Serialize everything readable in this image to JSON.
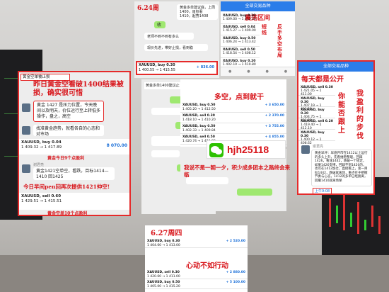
{
  "left_panel": {
    "chat_title": "黄金空单被止损",
    "headline": "昨日黄金空看破1400结果被损，确实很可惜",
    "msg1": "黄金 1427 是压力位置，今天晚间以及明天，价位运行至上转低多操作，盘之，高空",
    "msg2": "找准黄金趋势，就看各自的心态和对市场",
    "symbol": "XAUUSD, buy 0.04",
    "quote": "1 409.32 → 1 417.89",
    "profit": "8 070.00",
    "note": "黄金今日9个点盈利",
    "name": "谢君亮",
    "msg3": "黄金1421空单空，看跌，目标1414—1410 回1425",
    "red_caption": "今日早间pen回再次提供1421仲空!",
    "symbol2": "XAUUSD, sell 0.60",
    "quote2": "1 429.51 → 1 415.51",
    "note2": "黄金空单10个点盈利"
  },
  "top_mid": {
    "date_caption": "6.24周",
    "msg_top": "黄金多单建议底，上周1400，目标看1410，起势1408",
    "label": "收",
    "msg2": "老师不到不到有多么",
    "msg3": "现价先进，带好止损，看到稳",
    "symbol": "XAUUSD, buy 0.30",
    "quote": "1 400.55 → 1 415.55",
    "profit": "+ 836.00"
  },
  "top_right": {
    "app_title": "全部交易品种",
    "caption_right": "震荡区间",
    "caption_v1": "短线",
    "caption_v2": "反手多空布局",
    "rows": [
      {
        "sym": "XAUUSD, buy 0.30",
        "q": "1 409.00 → 1 412.30",
        "p": "+ 1 412.30"
      },
      {
        "sym": "XAUUSD, sell 0.04",
        "q": "1 415.27 → 1 409.00",
        "p": "+ 205.00"
      },
      {
        "sym": "XAUUSD, buy 0.50",
        "q": "1 406.24 → 1 413.42",
        "p": "+ 3 590.00"
      },
      {
        "sym": "XAUUSD, sell 0.50",
        "q": "1 418.54 → 1 408.12",
        "p": "+ 5 210.00"
      },
      {
        "sym": "XAUUSD, buy 0.20",
        "q": "1 402.10 → 1 410.80",
        "p": "+ 1 740.00"
      }
    ]
  },
  "center": {
    "chat_title": "黄金多单1400建议止",
    "caption": "多空，点到就干",
    "rows": [
      {
        "sym": "XAUUSD, buy 0.50",
        "q": "1 405.20 → 1 412.50",
        "p": "+ 3 650.00"
      },
      {
        "sym": "XAUUSD, sell 0.30",
        "q": "1 418.10 → 1 410.20",
        "p": "+ 2 370.00"
      },
      {
        "sym": "XAUUSD, buy 0.50",
        "q": "1 402.33 → 1 409.84",
        "p": "+ 3 755.00"
      },
      {
        "sym": "XAUUSD, sell 0.50",
        "q": "1 420.74 → 1 411.03",
        "p": "+ 4 855.00"
      }
    ],
    "wechat_id": "hjh25118",
    "caption2": "我说不是一朝一夕，积少成多团本之路终会来临"
  },
  "right_panel": {
    "app_title": "全部交易品种",
    "caption_top": "每天都是公开",
    "caption_v1": "你能否跟上",
    "caption_v2": "我盈利的步伐",
    "rows": [
      {
        "sym": "XAUUSD, sell 0.30",
        "q": "1 421.05 → 1 411.00",
        "p": "+ 4 000.00"
      },
      {
        "sym": "XAUUSD, buy 0.30",
        "q": "1 407.19 → 1 413.50",
        "p": "+ 1 893.00"
      },
      {
        "sym": "XAUUSD, buy 0.20",
        "q": "1 404.75 → 1 411.80",
        "p": "+ 1 410.00"
      },
      {
        "sym": "XAUUSD, sell 0.20",
        "q": "1 419.40 → 1 412.10",
        "p": "+ 1 460.00"
      },
      {
        "sym": "XAUUSD, buy 0.30",
        "q": "1 400.12 → 1 408.62",
        "p": "+ 2 550.00"
      }
    ],
    "name": "谢君亮",
    "msg": "黄金早评：早盘开市在1412以上运行的多头上升，先看维稳整理，回踩1426，看涨1442，跌破一个短定，如果1426支撑，回踩不到1420的，也可在1412加仓，直接看上，第一目标1442，跌破就离场，重点在于把握节奏与心态，1412的多单已经脱离，回撤1410就离场保",
    "time": "上午9:08"
  },
  "bottom_mid": {
    "date_caption": "6.27周四",
    "caption": "心动不如行动",
    "rows": [
      {
        "sym": "XAUUSD, buy 0.30",
        "q": "1 404.60 → 1 413.00",
        "p": "+ 2 520.00"
      },
      {
        "sym": "XAUUSD, sell 0.30",
        "q": "1 420.60 → 1 411.00",
        "p": "+ 2 880.00"
      },
      {
        "sym": "XAUUSD, buy 0.50",
        "q": "1 405.00 → 1 415.20",
        "p": "+ 5 100.00"
      }
    ]
  },
  "overlay_text": "收"
}
